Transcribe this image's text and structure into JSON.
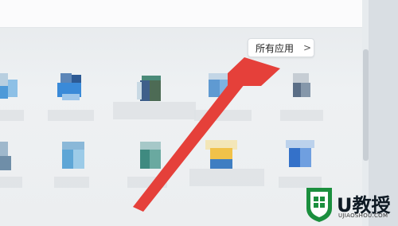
{
  "start_menu": {
    "all_apps_label": "所有应用",
    "all_apps_chevron": ">"
  },
  "arrow": {
    "color": "#e5403a"
  },
  "watermark": {
    "brand": "U教授",
    "site": "UJIAOSHOU.COM",
    "logo_color": "#1b8f3e"
  },
  "icons": {
    "chevron": "chevron-right-icon"
  }
}
